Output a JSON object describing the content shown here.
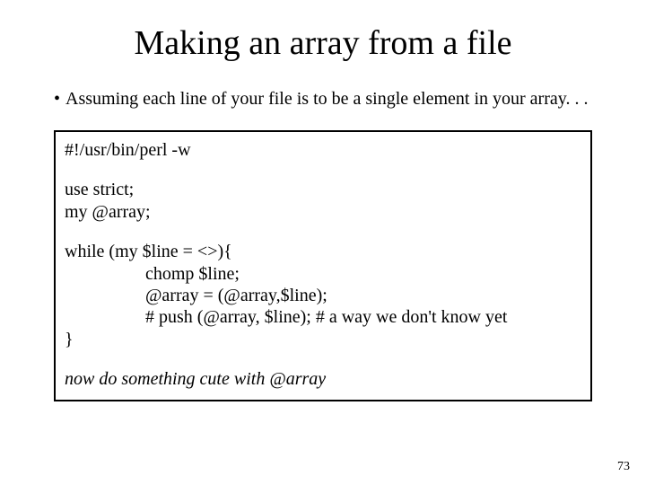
{
  "title": "Making an array from a file",
  "bullet": "Assuming each line of your file is to be a single element in your array. . .",
  "code": {
    "l1": "#!/usr/bin/perl -w",
    "l2": "use strict;",
    "l3": "my @array;",
    "l4": "while (my $line = <>){",
    "l5": "chomp $line;",
    "l6": "@array = (@array,$line);",
    "l7": "# push (@array, $line);  # a way we don't know yet",
    "l8": "}",
    "note": "now do something cute with @array"
  },
  "page_number": "73"
}
